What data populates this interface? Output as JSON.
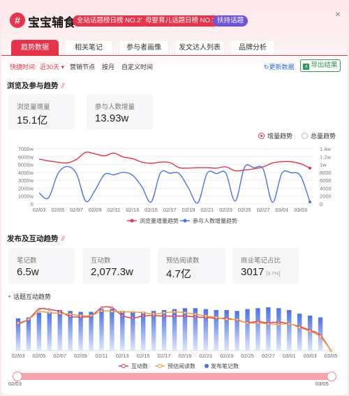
{
  "header": {
    "logo_char": "#",
    "title": "宝宝辅食",
    "badges": [
      {
        "label": "全站话题榜日榜 NO.25",
        "color": "#e8344a"
      },
      {
        "label": "母婴育儿话题日榜 NO.1",
        "color": "#e8344a"
      },
      {
        "label": "扶持话题",
        "color": "#6f54d8"
      }
    ],
    "close_icon": "×"
  },
  "tabs": [
    {
      "label": "趋势数据",
      "active": true
    },
    {
      "label": "相关笔记",
      "active": false
    },
    {
      "label": "参与者画像",
      "active": false
    },
    {
      "label": "发文达人列表",
      "active": false
    },
    {
      "label": "品牌分析",
      "active": false
    }
  ],
  "filter": {
    "quick_label": "快捷时间:",
    "range_value": "近30天",
    "options": [
      "营销节点",
      "按月",
      "自定义时间"
    ],
    "refresh_label": "更新数据",
    "export_label": "导出结果"
  },
  "section1": {
    "title": "浏览及参与趋势",
    "cards": [
      {
        "label": "浏览量增量",
        "value": "15.1亿"
      },
      {
        "label": "参与人数增量",
        "value": "13.93w"
      }
    ],
    "toggle": [
      {
        "label": "增量趋势",
        "selected": true
      },
      {
        "label": "总量趋势",
        "selected": false
      }
    ]
  },
  "section2": {
    "title": "发布及互动趋势",
    "cards": [
      {
        "label": "笔记数",
        "value": "6.5w",
        "sub": ""
      },
      {
        "label": "互动数",
        "value": "2,077.3w",
        "sub": ""
      },
      {
        "label": "预估阅读数",
        "value": "4.7亿",
        "sub": ""
      },
      {
        "label": "商业笔记占比",
        "value": "3017",
        "sub": "[4.7%]"
      }
    ],
    "sublabel": "话题互动趋势"
  },
  "slider": {
    "start": "02/03",
    "end": "03/05"
  },
  "colors": {
    "accent": "#e8344a",
    "red_series": "#e8344a",
    "blue_series": "#4a72e8",
    "orange_series": "#f29a2e"
  },
  "chart_data": [
    {
      "type": "line",
      "x": [
        "02/03",
        "02/04",
        "02/05",
        "02/06",
        "02/07",
        "02/08",
        "02/09",
        "02/10",
        "02/11",
        "02/12",
        "02/13",
        "02/14",
        "02/15",
        "02/16",
        "02/17",
        "02/18",
        "02/19",
        "02/20",
        "02/21",
        "02/22",
        "02/23",
        "02/24",
        "02/25",
        "02/26",
        "02/27",
        "02/28",
        "03/01",
        "03/02",
        "03/03",
        "03/04"
      ],
      "xticks": [
        "02/03",
        "02/05",
        "02/07",
        "02/09",
        "02/11",
        "02/13",
        "02/15",
        "02/17",
        "02/19",
        "02/21",
        "02/23",
        "02/25",
        "02/27",
        "03/01",
        "03/03"
      ],
      "left_axis": {
        "ticks": [
          "0",
          "1000w",
          "2000w",
          "3000w",
          "4000w",
          "5000w",
          "6000w",
          "7000w"
        ],
        "ylim": [
          0,
          7000
        ]
      },
      "right_axis": {
        "ticks": [
          "0",
          "2000",
          "4000",
          "6000",
          "8000",
          "1w",
          "1.2w",
          "1.4w"
        ],
        "ylim": [
          0,
          14000
        ]
      },
      "series": [
        {
          "name": "浏览量增量趋势",
          "axis": "left",
          "color": "#e8344a",
          "values": [
            5700,
            5450,
            5300,
            5200,
            5650,
            6550,
            6350,
            6100,
            6450,
            5950,
            5750,
            5300,
            5150,
            5300,
            5250,
            4600,
            4550,
            4600,
            4600,
            4550,
            4700,
            4200,
            4300,
            4450,
            4700,
            5200,
            5350,
            5350,
            5100,
            4550
          ]
        },
        {
          "name": "参与人数增量趋势",
          "axis": "right",
          "color": "#4a72e8",
          "values": [
            2800,
            1500,
            7600,
            9500,
            7700,
            700,
            3500,
            7500,
            7400,
            8000,
            7300,
            4400,
            500,
            7900,
            7800,
            7700,
            4000,
            300,
            7800,
            7700,
            7800,
            700,
            9300,
            9200,
            8800,
            400,
            7800,
            7900,
            7100,
            500
          ]
        }
      ]
    },
    {
      "type": "bar",
      "x": [
        "02/03",
        "02/04",
        "02/05",
        "02/06",
        "02/07",
        "02/08",
        "02/09",
        "02/10",
        "02/11",
        "02/12",
        "02/13",
        "02/14",
        "02/15",
        "02/16",
        "02/17",
        "02/18",
        "02/19",
        "02/20",
        "02/21",
        "02/22",
        "02/23",
        "02/24",
        "02/25",
        "02/26",
        "02/27",
        "02/28",
        "03/01",
        "03/02",
        "03/03",
        "03/04",
        "03/05"
      ],
      "xticks": [
        "02/03",
        "02/05",
        "02/07",
        "02/09",
        "02/11",
        "02/13",
        "02/15",
        "02/17",
        "02/19",
        "02/21",
        "02/23",
        "02/25",
        "02/27",
        "03/01",
        "03/03",
        "03/05"
      ],
      "ylim": [
        0,
        100
      ],
      "series": [
        {
          "name": "互动数",
          "kind": "line",
          "color": "#e8344a",
          "values": [
            58,
            68,
            90,
            89,
            85,
            74,
            73,
            75,
            93,
            93,
            76,
            71,
            75,
            76,
            75,
            75,
            75,
            73,
            72,
            70,
            70,
            66,
            61,
            63,
            60,
            62,
            58,
            52,
            44,
            33,
            0
          ]
        },
        {
          "name": "预估阅读数",
          "kind": "line",
          "color": "#f29a2e",
          "values": [
            60,
            68,
            84,
            82,
            81,
            79,
            76,
            76,
            86,
            85,
            84,
            84,
            82,
            80,
            82,
            84,
            82,
            79,
            75,
            72,
            68,
            67,
            60,
            60,
            58,
            57,
            58,
            50,
            42,
            30,
            0
          ]
        },
        {
          "name": "发布笔记数",
          "kind": "bar",
          "color": "#4a72e8",
          "values": [
            70,
            72,
            82,
            84,
            88,
            86,
            84,
            84,
            90,
            90,
            86,
            84,
            84,
            86,
            88,
            90,
            92,
            92,
            90,
            88,
            88,
            86,
            90,
            92,
            94,
            92,
            88,
            80,
            76,
            72,
            0
          ]
        }
      ]
    }
  ]
}
